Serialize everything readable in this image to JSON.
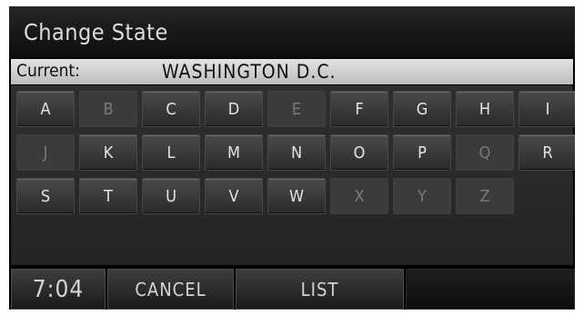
{
  "header": {
    "title": "Change State"
  },
  "current": {
    "label": "Current:",
    "value": "WASHINGTON D.C."
  },
  "keys": [
    {
      "letter": "A",
      "enabled": true
    },
    {
      "letter": "B",
      "enabled": false
    },
    {
      "letter": "C",
      "enabled": true
    },
    {
      "letter": "D",
      "enabled": true
    },
    {
      "letter": "E",
      "enabled": false
    },
    {
      "letter": "F",
      "enabled": true
    },
    {
      "letter": "G",
      "enabled": true
    },
    {
      "letter": "H",
      "enabled": true
    },
    {
      "letter": "I",
      "enabled": true
    },
    {
      "letter": "J",
      "enabled": false
    },
    {
      "letter": "K",
      "enabled": true
    },
    {
      "letter": "L",
      "enabled": true
    },
    {
      "letter": "M",
      "enabled": true
    },
    {
      "letter": "N",
      "enabled": true
    },
    {
      "letter": "O",
      "enabled": true
    },
    {
      "letter": "P",
      "enabled": true
    },
    {
      "letter": "Q",
      "enabled": false
    },
    {
      "letter": "R",
      "enabled": true
    },
    {
      "letter": "S",
      "enabled": true
    },
    {
      "letter": "T",
      "enabled": true
    },
    {
      "letter": "U",
      "enabled": true
    },
    {
      "letter": "V",
      "enabled": true
    },
    {
      "letter": "W",
      "enabled": true
    },
    {
      "letter": "X",
      "enabled": false
    },
    {
      "letter": "Y",
      "enabled": false
    },
    {
      "letter": "Z",
      "enabled": false
    }
  ],
  "footer": {
    "clock": "7:04",
    "cancel_label": "CANCEL",
    "list_label": "LIST"
  }
}
